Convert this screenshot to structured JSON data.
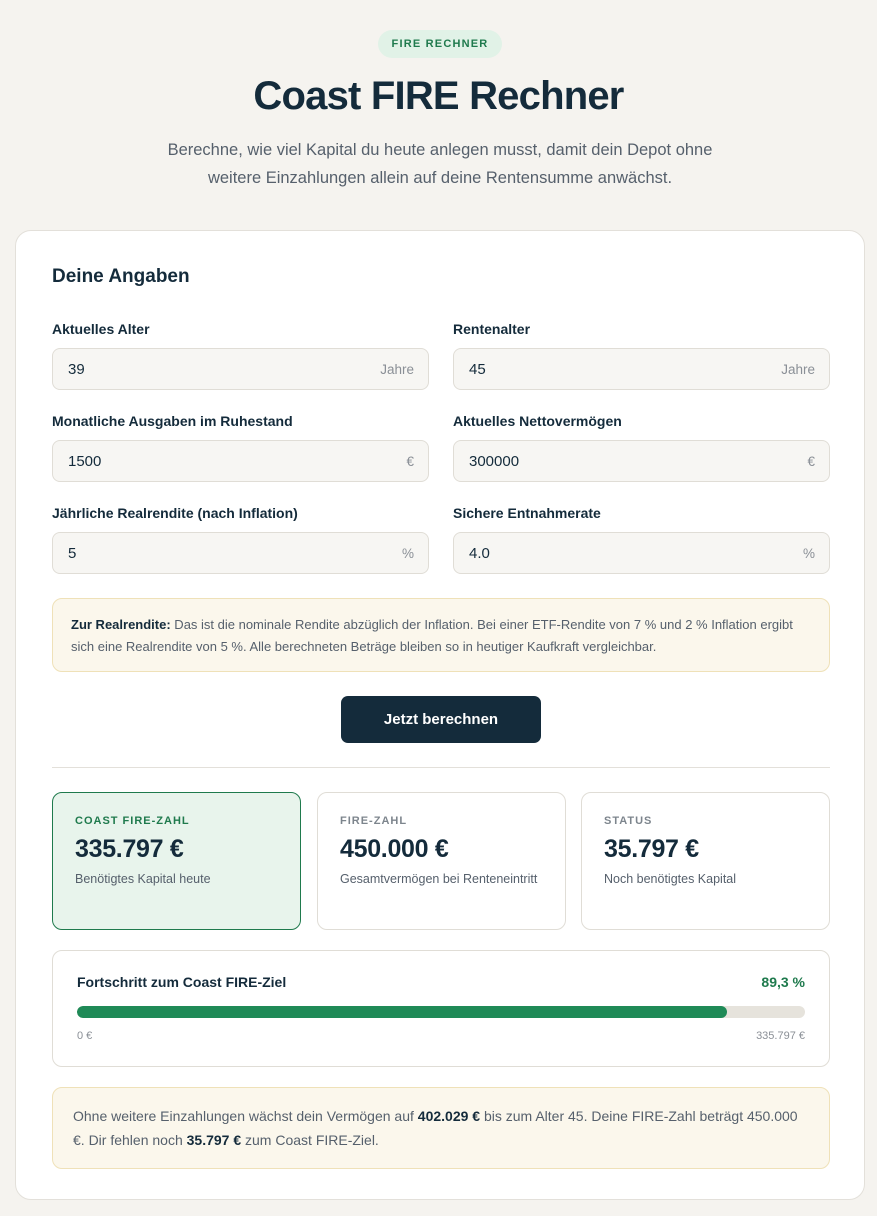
{
  "header": {
    "badge": "FIRE RECHNER",
    "title": "Coast FIRE Rechner",
    "subtitle": "Berechne, wie viel Kapital du heute anlegen musst, damit dein Depot ohne weitere Einzahlungen allein auf deine Rentensumme anwächst."
  },
  "form": {
    "section_title": "Deine Angaben",
    "fields": [
      {
        "label": "Aktuelles Alter",
        "value": "39",
        "unit": "Jahre"
      },
      {
        "label": "Rentenalter",
        "value": "45",
        "unit": "Jahre"
      },
      {
        "label": "Monatliche Ausgaben im Ruhestand",
        "value": "1500",
        "unit": "€"
      },
      {
        "label": "Aktuelles Nettovermögen",
        "value": "300000",
        "unit": "€"
      },
      {
        "label": "Jährliche Realrendite (nach Inflation)",
        "value": "5",
        "unit": "%"
      },
      {
        "label": "Sichere Entnahmerate",
        "value": "4.0",
        "unit": "%"
      }
    ],
    "note": {
      "bold": "Zur Realrendite:",
      "text": " Das ist die nominale Rendite abzüglich der Inflation. Bei einer ETF-Rendite von 7 % und 2 % Inflation ergibt sich eine Realrendite von 5 %. Alle berechneten Beträge bleiben so in heutiger Kaufkraft vergleichbar."
    },
    "calculate_label": "Jetzt berechnen"
  },
  "results": {
    "stats": [
      {
        "label": "COAST FIRE-ZAHL",
        "value": "335.797 €",
        "caption": "Benötigtes Kapital heute"
      },
      {
        "label": "FIRE-ZAHL",
        "value": "450.000 €",
        "caption": "Gesamtvermögen bei Renteneintritt"
      },
      {
        "label": "STATUS",
        "value": "35.797 €",
        "caption": "Noch benötigtes Kapital"
      }
    ],
    "progress": {
      "title": "Fortschritt zum Coast FIRE-Ziel",
      "percent_label": "89,3 %",
      "fraction": 0.893,
      "min_label": "0 €",
      "max_label": "335.797 €"
    },
    "summary": {
      "t1": "Ohne weitere Einzahlungen wächst dein Vermögen auf ",
      "b1": "402.029 €",
      "t2": " bis zum Alter 45. Deine FIRE-Zahl beträgt 450.000 €. Dir fehlen noch ",
      "b2": "35.797 €",
      "t3": " zum Coast FIRE-Ziel."
    }
  },
  "colors": {
    "accent_green": "#1f7a4d",
    "progress_fill": "#1f8a57",
    "primary_dark": "#142b3b",
    "background": "#f5f3ef"
  }
}
